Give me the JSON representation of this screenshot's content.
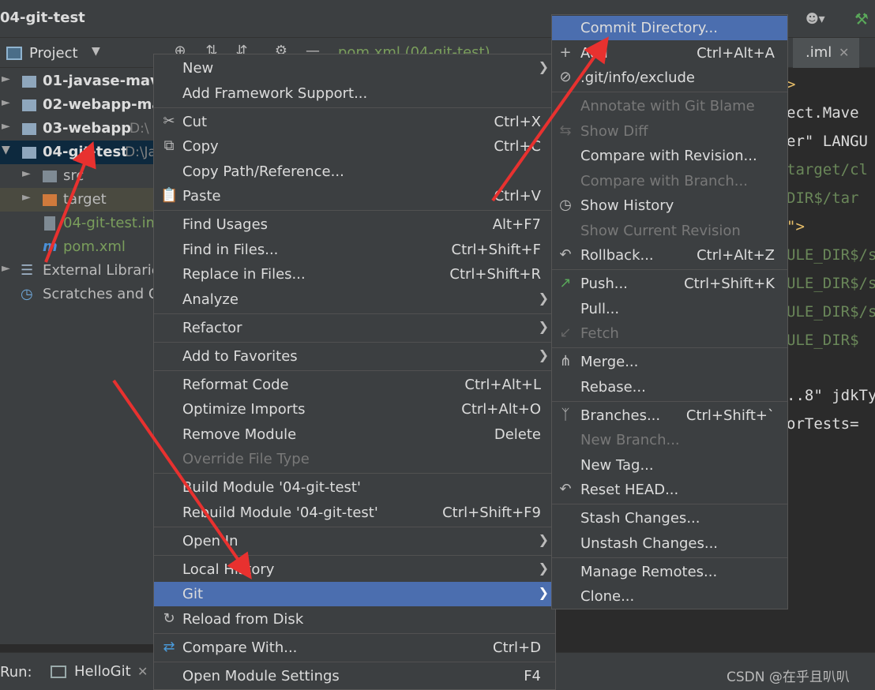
{
  "titlebar": {
    "title": "04-git-test",
    "user_icon": "user-icon",
    "hammer_icon": "hammer-icon"
  },
  "project_toolbar": {
    "label": "Project"
  },
  "editor_tabs": {
    "pom": "pom.xml (04-git-test)",
    "iml": ".iml"
  },
  "tree": {
    "items": [
      {
        "label": "01-javase-mave",
        "path": ""
      },
      {
        "label": "02-webapp-mav",
        "path": ""
      },
      {
        "label": "03-webapp",
        "path": "D:\\"
      },
      {
        "label": "04-git-test",
        "path": "D:\\Ja"
      },
      {
        "label": "src",
        "path": ""
      },
      {
        "label": "target",
        "path": ""
      },
      {
        "label": "04-git-test.im",
        "path": ""
      },
      {
        "label": "pom.xml",
        "path": ""
      },
      {
        "label": "External Librarie",
        "path": ""
      },
      {
        "label": "Scratches and Co",
        "path": ""
      }
    ]
  },
  "code": {
    "lines": [
      ">",
      "ect.Mave",
      "er\" LANGU",
      "target/cl",
      "DIR$/tar",
      "\">",
      "ULE_DIR$/s",
      "ULE_DIR$/s",
      "ULE_DIR$/s",
      "ULE_DIR$",
      "",
      "..8\" jdkTy",
      "orTests="
    ]
  },
  "context_menu": {
    "items": [
      {
        "label": "New",
        "shortcut": "",
        "submenu": true
      },
      {
        "label": "Add Framework Support...",
        "shortcut": ""
      },
      {
        "label": "Cut",
        "shortcut": "Ctrl+X",
        "icon": "scissors-icon"
      },
      {
        "label": "Copy",
        "shortcut": "Ctrl+C",
        "icon": "copy-icon"
      },
      {
        "label": "Copy Path/Reference...",
        "shortcut": ""
      },
      {
        "label": "Paste",
        "shortcut": "Ctrl+V",
        "icon": "clipboard-icon"
      },
      {
        "label": "Find Usages",
        "shortcut": "Alt+F7"
      },
      {
        "label": "Find in Files...",
        "shortcut": "Ctrl+Shift+F"
      },
      {
        "label": "Replace in Files...",
        "shortcut": "Ctrl+Shift+R"
      },
      {
        "label": "Analyze",
        "shortcut": "",
        "submenu": true
      },
      {
        "label": "Refactor",
        "shortcut": "",
        "submenu": true
      },
      {
        "label": "Add to Favorites",
        "shortcut": "",
        "submenu": true
      },
      {
        "label": "Reformat Code",
        "shortcut": "Ctrl+Alt+L"
      },
      {
        "label": "Optimize Imports",
        "shortcut": "Ctrl+Alt+O"
      },
      {
        "label": "Remove Module",
        "shortcut": "Delete"
      },
      {
        "label": "Override File Type",
        "shortcut": "",
        "disabled": true
      },
      {
        "label": "Build Module '04-git-test'",
        "shortcut": ""
      },
      {
        "label": "Rebuild Module '04-git-test'",
        "shortcut": "Ctrl+Shift+F9"
      },
      {
        "label": "Open In",
        "shortcut": "",
        "submenu": true
      },
      {
        "label": "Local History",
        "shortcut": "",
        "submenu": true
      },
      {
        "label": "Git",
        "shortcut": "",
        "submenu": true,
        "highlight": true
      },
      {
        "label": "Reload from Disk",
        "shortcut": "",
        "icon": "reload-icon"
      },
      {
        "label": "Compare With...",
        "shortcut": "Ctrl+D",
        "icon": "compare-icon"
      },
      {
        "label": "Open Module Settings",
        "shortcut": "F4"
      }
    ]
  },
  "git_menu": {
    "items": [
      {
        "label": "Commit Directory...",
        "shortcut": "",
        "highlight": true
      },
      {
        "label": "Add",
        "shortcut": "Ctrl+Alt+A",
        "icon": "plus-icon"
      },
      {
        "label": ".git/info/exclude",
        "shortcut": "",
        "icon": "exclude-file-icon"
      },
      {
        "label": "Annotate with Git Blame",
        "shortcut": "",
        "disabled": true
      },
      {
        "label": "Show Diff",
        "shortcut": "",
        "disabled": true,
        "icon": "diff-icon"
      },
      {
        "label": "Compare with Revision...",
        "shortcut": ""
      },
      {
        "label": "Compare with Branch...",
        "shortcut": "",
        "disabled": true
      },
      {
        "label": "Show History",
        "shortcut": "",
        "icon": "clock-icon"
      },
      {
        "label": "Show Current Revision",
        "shortcut": "",
        "disabled": true
      },
      {
        "label": "Rollback...",
        "shortcut": "Ctrl+Alt+Z",
        "icon": "rollback-icon"
      },
      {
        "label": "Push...",
        "shortcut": "Ctrl+Shift+K",
        "icon": "push-icon"
      },
      {
        "label": "Pull...",
        "shortcut": ""
      },
      {
        "label": "Fetch",
        "shortcut": "",
        "disabled": true,
        "icon": "fetch-icon"
      },
      {
        "label": "Merge...",
        "shortcut": "",
        "icon": "merge-icon"
      },
      {
        "label": "Rebase...",
        "shortcut": ""
      },
      {
        "label": "Branches...",
        "shortcut": "Ctrl+Shift+`",
        "icon": "branch-icon"
      },
      {
        "label": "New Branch...",
        "shortcut": "",
        "disabled": true
      },
      {
        "label": "New Tag...",
        "shortcut": ""
      },
      {
        "label": "Reset HEAD...",
        "shortcut": "",
        "icon": "reset-icon"
      },
      {
        "label": "Stash Changes...",
        "shortcut": ""
      },
      {
        "label": "Unstash Changes...",
        "shortcut": ""
      },
      {
        "label": "Manage Remotes...",
        "shortcut": ""
      },
      {
        "label": "Clone...",
        "shortcut": ""
      }
    ]
  },
  "runbar": {
    "label": "Run:",
    "tab": "HelloGit"
  },
  "watermark": "CSDN @在乎且叭叭",
  "colors": {
    "highlight": "#4b6eaf",
    "menu_bg": "#3c3f41",
    "arrow": "#e8312f"
  }
}
